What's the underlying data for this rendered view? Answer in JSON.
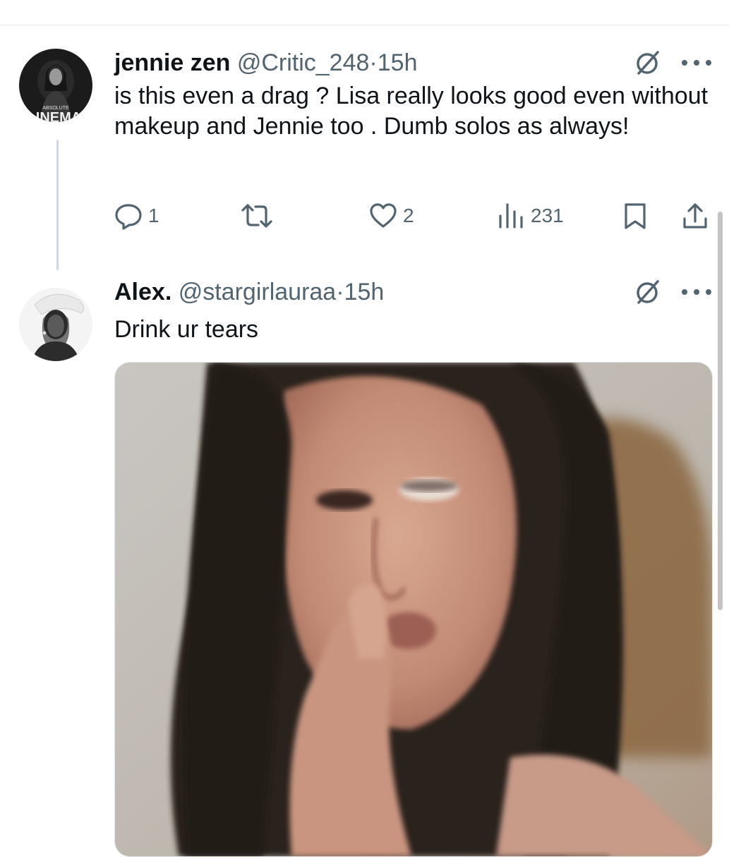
{
  "tweet1": {
    "display_name": "jennie zen",
    "handle": "@Critic_248",
    "separator": "·",
    "time": "15h",
    "avatar_text_top": "ABSOLUTE",
    "avatar_text_main": "INEMA",
    "text": "is this even a drag ? Lisa really looks good even without makeup and Jennie too . Dumb solos as always!",
    "replies": "1",
    "likes": "2",
    "views": "231"
  },
  "tweet2": {
    "display_name": "Alex.",
    "handle": "@stargirlauraa",
    "separator": "·",
    "time": "15h",
    "text": "Drink ur tears"
  },
  "icons": {
    "grok": "grok-icon",
    "more": "more-dots-icon",
    "reply": "reply-icon",
    "retweet": "retweet-icon",
    "like": "heart-icon",
    "views": "views-chart-icon",
    "bookmark": "bookmark-icon",
    "share": "share-icon"
  },
  "colors": {
    "text": "#0f1419",
    "secondary": "#536471",
    "thread_line": "#cfd9de"
  }
}
